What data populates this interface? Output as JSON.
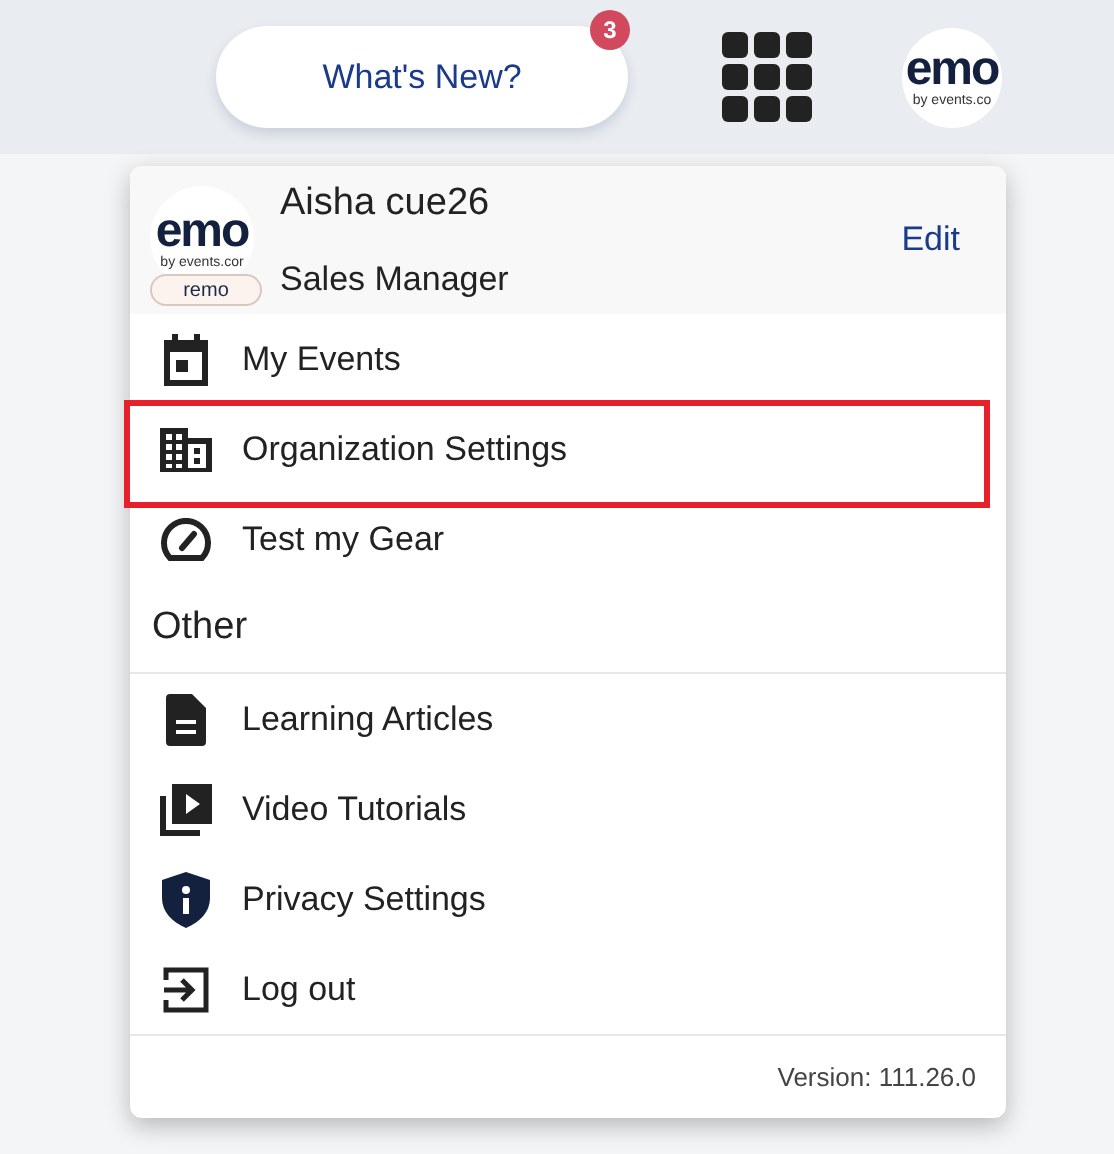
{
  "top_bar": {
    "whats_new": {
      "label": "What's New?",
      "badge": "3"
    },
    "avatar": {
      "wordmark": "emo",
      "tagline": "by events.co"
    }
  },
  "profile": {
    "name": "Aisha cue26",
    "role": "Sales Manager",
    "edit": "Edit",
    "avatar": {
      "wordmark": "emo",
      "tagline": "by events.cor"
    },
    "badge": "remo"
  },
  "items": [
    {
      "label": "My Events",
      "highlighted": false
    },
    {
      "label": "Organization Settings",
      "highlighted": true
    },
    {
      "label": "Test my Gear",
      "highlighted": false
    }
  ],
  "other": {
    "heading": "Other",
    "items": [
      {
        "label": "Learning Articles"
      },
      {
        "label": "Video Tutorials"
      },
      {
        "label": "Privacy Settings"
      },
      {
        "label": "Log out"
      }
    ]
  },
  "version": "Version: 111.26.0"
}
